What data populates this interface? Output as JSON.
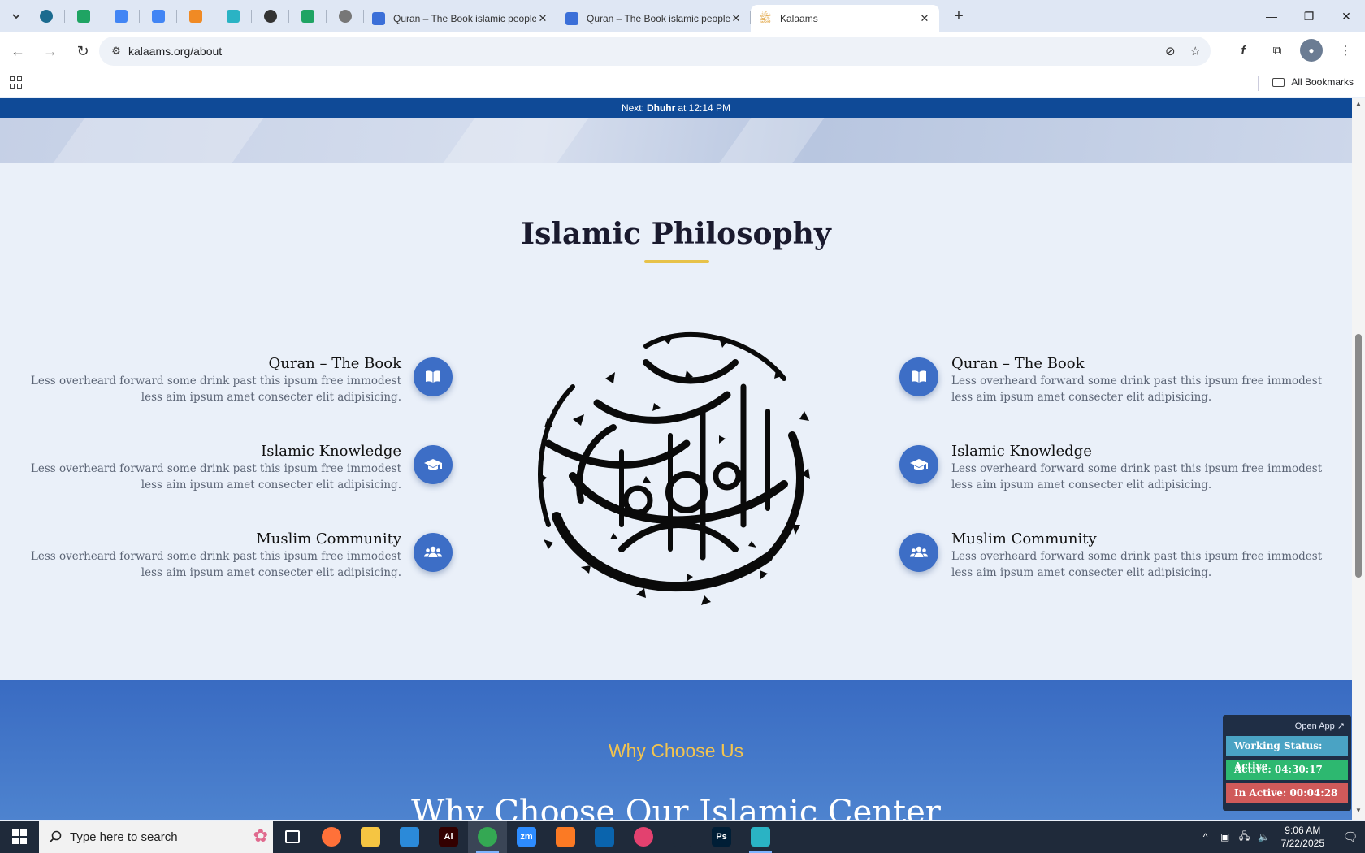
{
  "browser": {
    "tabs": [
      {
        "title": "Quran – The Book islamic people",
        "favicon_color": "#3b6fd8"
      },
      {
        "title": "Quran – The Book islamic people",
        "favicon_color": "#3b6fd8"
      },
      {
        "title": "Kalaams",
        "favicon_color": "#e0a13a",
        "active": true
      }
    ],
    "pinned_tabs": [
      {
        "icon": "wordpress-icon",
        "color": "#1b6b8f"
      },
      {
        "icon": "sheets-icon",
        "color": "#1fa463"
      },
      {
        "icon": "docs-icon",
        "color": "#4285f4"
      },
      {
        "icon": "docs-icon",
        "color": "#4285f4"
      },
      {
        "icon": "xampp-icon",
        "color": "#f08a24"
      },
      {
        "icon": "gem-icon",
        "color": "#2ab3c4"
      },
      {
        "icon": "openai-icon",
        "color": "#333333"
      },
      {
        "icon": "sheets-icon",
        "color": "#1fa463"
      },
      {
        "icon": "globe-icon",
        "color": "#777777"
      }
    ],
    "new_tab_label": "+",
    "url": "kalaams.org/about",
    "bookmarks_label": "All Bookmarks"
  },
  "page": {
    "prayer": {
      "prefix": "Next:",
      "name": "Dhuhr",
      "suffix": "at 12:14 PM"
    },
    "section_title": "Islamic Philosophy",
    "features_left": [
      {
        "title": "Quran – The Book",
        "text": "Less overheard forward some drink past this ipsum free immodest less aim ipsum amet consecter elit adipisicing.",
        "icon": "book-icon"
      },
      {
        "title": "Islamic Knowledge",
        "text": "Less overheard forward some drink past this ipsum free immodest less aim ipsum amet consecter elit adipisicing.",
        "icon": "graduation-cap-icon"
      },
      {
        "title": "Muslim Community",
        "text": "Less overheard forward some drink past this ipsum free immodest less aim ipsum amet consecter elit adipisicing.",
        "icon": "users-icon"
      }
    ],
    "features_right": [
      {
        "title": "Quran – The Book",
        "text": "Less overheard forward some drink past this ipsum free immodest less aim ipsum amet consecter elit adipisicing.",
        "icon": "book-icon"
      },
      {
        "title": "Islamic Knowledge",
        "text": "Less overheard forward some drink past this ipsum free immodest less aim ipsum amet consecter elit adipisicing.",
        "icon": "graduation-cap-icon"
      },
      {
        "title": "Muslim Community",
        "text": "Less overheard forward some drink past this ipsum free immodest less aim ipsum amet consecter elit adipisicing.",
        "icon": "users-icon"
      }
    ],
    "why_eyebrow": "Why Choose Us",
    "why_heading": "Why Choose Our Islamic Center"
  },
  "widget": {
    "open_app": "Open App ↗",
    "working_status": "Working Status: Active",
    "active": "Active: 04:30:17",
    "inactive": "In Active: 00:04:28"
  },
  "taskbar": {
    "search_placeholder": "Type here to search",
    "apps": [
      {
        "name": "task-view",
        "label": "",
        "color": "#1f2a3a"
      },
      {
        "name": "firefox",
        "label": "",
        "color": "#ff7139"
      },
      {
        "name": "file-explorer",
        "label": "",
        "color": "#f5c542"
      },
      {
        "name": "vscode",
        "label": "",
        "color": "#2b8ad9"
      },
      {
        "name": "illustrator",
        "label": "Ai",
        "color": "#330000"
      },
      {
        "name": "chrome",
        "label": "",
        "color": "#34a853"
      },
      {
        "name": "zoom",
        "label": "zm",
        "color": "#2d8cff"
      },
      {
        "name": "xampp",
        "label": "",
        "color": "#fb7a24"
      },
      {
        "name": "outlook",
        "label": "",
        "color": "#0a64ad"
      },
      {
        "name": "creative-cloud",
        "label": "",
        "color": "#e3416f"
      },
      {
        "name": "pen-tool",
        "label": "",
        "color": "#1f2a3a"
      },
      {
        "name": "photoshop",
        "label": "Ps",
        "color": "#001e36"
      },
      {
        "name": "gem-app",
        "label": "",
        "color": "#2ab3c4"
      }
    ],
    "time": "9:06 AM",
    "date": "7/22/2025"
  },
  "colors": {
    "brand_blue": "#3d6ec6",
    "accent_gold": "#e7c24a",
    "prayer_bar": "#0f4a97",
    "widget_status": "#4aa3c4",
    "widget_active": "#2db870",
    "widget_inactive": "#d05a5a"
  }
}
